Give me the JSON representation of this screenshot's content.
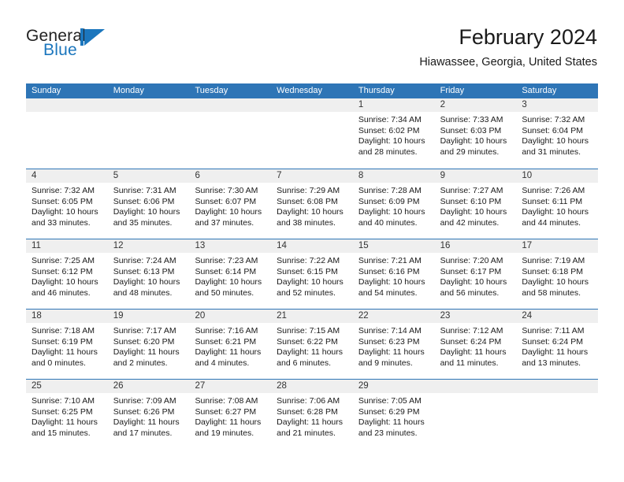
{
  "brand": {
    "name_part1": "General",
    "name_part2": "Blue",
    "mark": "triangle-sail-logo",
    "color": "#1b76bd"
  },
  "header": {
    "title": "February 2024",
    "subtitle": "Hiawassee, Georgia, United States"
  },
  "theme": {
    "header_blue": "#2e75b6",
    "day_strip_gray": "#efefef",
    "text": "#1a1a1a"
  },
  "calendar": {
    "weekdays": [
      "Sunday",
      "Monday",
      "Tuesday",
      "Wednesday",
      "Thursday",
      "Friday",
      "Saturday"
    ],
    "weeks": [
      [
        {
          "day": "",
          "empty": true
        },
        {
          "day": "",
          "empty": true
        },
        {
          "day": "",
          "empty": true
        },
        {
          "day": "",
          "empty": true
        },
        {
          "day": "1",
          "sunrise": "Sunrise: 7:34 AM",
          "sunset": "Sunset: 6:02 PM",
          "daylight": "Daylight: 10 hours and 28 minutes."
        },
        {
          "day": "2",
          "sunrise": "Sunrise: 7:33 AM",
          "sunset": "Sunset: 6:03 PM",
          "daylight": "Daylight: 10 hours and 29 minutes."
        },
        {
          "day": "3",
          "sunrise": "Sunrise: 7:32 AM",
          "sunset": "Sunset: 6:04 PM",
          "daylight": "Daylight: 10 hours and 31 minutes."
        }
      ],
      [
        {
          "day": "4",
          "sunrise": "Sunrise: 7:32 AM",
          "sunset": "Sunset: 6:05 PM",
          "daylight": "Daylight: 10 hours and 33 minutes."
        },
        {
          "day": "5",
          "sunrise": "Sunrise: 7:31 AM",
          "sunset": "Sunset: 6:06 PM",
          "daylight": "Daylight: 10 hours and 35 minutes."
        },
        {
          "day": "6",
          "sunrise": "Sunrise: 7:30 AM",
          "sunset": "Sunset: 6:07 PM",
          "daylight": "Daylight: 10 hours and 37 minutes."
        },
        {
          "day": "7",
          "sunrise": "Sunrise: 7:29 AM",
          "sunset": "Sunset: 6:08 PM",
          "daylight": "Daylight: 10 hours and 38 minutes."
        },
        {
          "day": "8",
          "sunrise": "Sunrise: 7:28 AM",
          "sunset": "Sunset: 6:09 PM",
          "daylight": "Daylight: 10 hours and 40 minutes."
        },
        {
          "day": "9",
          "sunrise": "Sunrise: 7:27 AM",
          "sunset": "Sunset: 6:10 PM",
          "daylight": "Daylight: 10 hours and 42 minutes."
        },
        {
          "day": "10",
          "sunrise": "Sunrise: 7:26 AM",
          "sunset": "Sunset: 6:11 PM",
          "daylight": "Daylight: 10 hours and 44 minutes."
        }
      ],
      [
        {
          "day": "11",
          "sunrise": "Sunrise: 7:25 AM",
          "sunset": "Sunset: 6:12 PM",
          "daylight": "Daylight: 10 hours and 46 minutes."
        },
        {
          "day": "12",
          "sunrise": "Sunrise: 7:24 AM",
          "sunset": "Sunset: 6:13 PM",
          "daylight": "Daylight: 10 hours and 48 minutes."
        },
        {
          "day": "13",
          "sunrise": "Sunrise: 7:23 AM",
          "sunset": "Sunset: 6:14 PM",
          "daylight": "Daylight: 10 hours and 50 minutes."
        },
        {
          "day": "14",
          "sunrise": "Sunrise: 7:22 AM",
          "sunset": "Sunset: 6:15 PM",
          "daylight": "Daylight: 10 hours and 52 minutes."
        },
        {
          "day": "15",
          "sunrise": "Sunrise: 7:21 AM",
          "sunset": "Sunset: 6:16 PM",
          "daylight": "Daylight: 10 hours and 54 minutes."
        },
        {
          "day": "16",
          "sunrise": "Sunrise: 7:20 AM",
          "sunset": "Sunset: 6:17 PM",
          "daylight": "Daylight: 10 hours and 56 minutes."
        },
        {
          "day": "17",
          "sunrise": "Sunrise: 7:19 AM",
          "sunset": "Sunset: 6:18 PM",
          "daylight": "Daylight: 10 hours and 58 minutes."
        }
      ],
      [
        {
          "day": "18",
          "sunrise": "Sunrise: 7:18 AM",
          "sunset": "Sunset: 6:19 PM",
          "daylight": "Daylight: 11 hours and 0 minutes."
        },
        {
          "day": "19",
          "sunrise": "Sunrise: 7:17 AM",
          "sunset": "Sunset: 6:20 PM",
          "daylight": "Daylight: 11 hours and 2 minutes."
        },
        {
          "day": "20",
          "sunrise": "Sunrise: 7:16 AM",
          "sunset": "Sunset: 6:21 PM",
          "daylight": "Daylight: 11 hours and 4 minutes."
        },
        {
          "day": "21",
          "sunrise": "Sunrise: 7:15 AM",
          "sunset": "Sunset: 6:22 PM",
          "daylight": "Daylight: 11 hours and 6 minutes."
        },
        {
          "day": "22",
          "sunrise": "Sunrise: 7:14 AM",
          "sunset": "Sunset: 6:23 PM",
          "daylight": "Daylight: 11 hours and 9 minutes."
        },
        {
          "day": "23",
          "sunrise": "Sunrise: 7:12 AM",
          "sunset": "Sunset: 6:24 PM",
          "daylight": "Daylight: 11 hours and 11 minutes."
        },
        {
          "day": "24",
          "sunrise": "Sunrise: 7:11 AM",
          "sunset": "Sunset: 6:24 PM",
          "daylight": "Daylight: 11 hours and 13 minutes."
        }
      ],
      [
        {
          "day": "25",
          "sunrise": "Sunrise: 7:10 AM",
          "sunset": "Sunset: 6:25 PM",
          "daylight": "Daylight: 11 hours and 15 minutes."
        },
        {
          "day": "26",
          "sunrise": "Sunrise: 7:09 AM",
          "sunset": "Sunset: 6:26 PM",
          "daylight": "Daylight: 11 hours and 17 minutes."
        },
        {
          "day": "27",
          "sunrise": "Sunrise: 7:08 AM",
          "sunset": "Sunset: 6:27 PM",
          "daylight": "Daylight: 11 hours and 19 minutes."
        },
        {
          "day": "28",
          "sunrise": "Sunrise: 7:06 AM",
          "sunset": "Sunset: 6:28 PM",
          "daylight": "Daylight: 11 hours and 21 minutes."
        },
        {
          "day": "29",
          "sunrise": "Sunrise: 7:05 AM",
          "sunset": "Sunset: 6:29 PM",
          "daylight": "Daylight: 11 hours and 23 minutes."
        },
        {
          "day": "",
          "empty": true
        },
        {
          "day": "",
          "empty": true
        }
      ]
    ]
  }
}
